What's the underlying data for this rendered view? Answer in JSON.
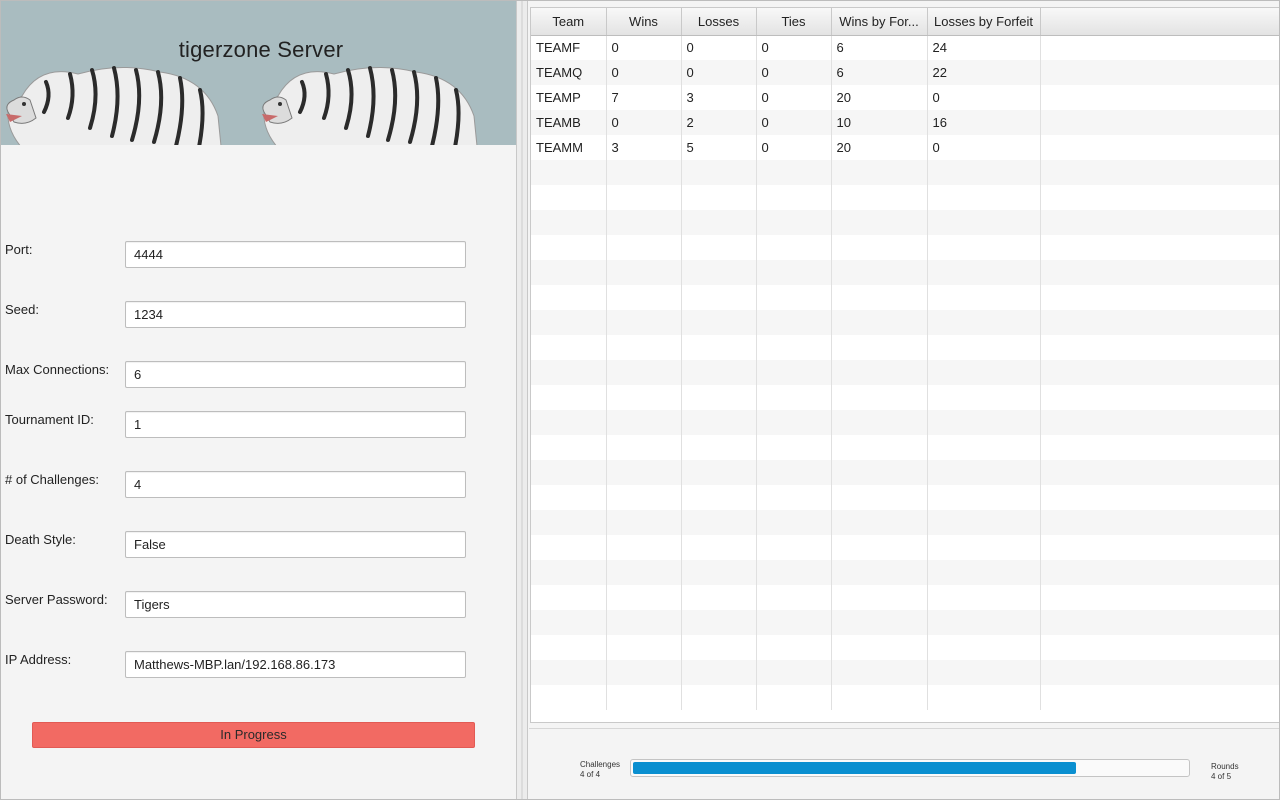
{
  "banner": {
    "title": "tigerzone Server"
  },
  "form": {
    "port": {
      "label": "Port:",
      "value": "4444"
    },
    "seed": {
      "label": "Seed:",
      "value": "1234"
    },
    "max_connections": {
      "label": "Max Connections:",
      "value": "6"
    },
    "tournament_id": {
      "label": "Tournament ID:",
      "value": "1"
    },
    "challenges": {
      "label": "# of Challenges:",
      "value": "4"
    },
    "death_style": {
      "label": "Death Style:",
      "value": "False"
    },
    "server_password": {
      "label": "Server Password:",
      "value": "Tigers"
    },
    "ip_address": {
      "label": "IP Address:",
      "value": "Matthews-MBP.lan/192.168.86.173"
    }
  },
  "status_button": {
    "label": "In Progress",
    "color": "#f26a63"
  },
  "table": {
    "columns": [
      "Team",
      "Wins",
      "Losses",
      "Ties",
      "Wins by For...",
      "Losses by Forfeit"
    ],
    "rows": [
      [
        "TEAMF",
        "0",
        "0",
        "0",
        "6",
        "24"
      ],
      [
        "TEAMQ",
        "0",
        "0",
        "0",
        "6",
        "22"
      ],
      [
        "TEAMP",
        "7",
        "3",
        "0",
        "20",
        "0"
      ],
      [
        "TEAMB",
        "0",
        "2",
        "0",
        "10",
        "16"
      ],
      [
        "TEAMM",
        "3",
        "5",
        "0",
        "20",
        "0"
      ]
    ]
  },
  "progress": {
    "challenges_label": "Challenges",
    "challenges_value": "4 of 4",
    "rounds_label": "Rounds",
    "rounds_value": "4 of 5",
    "fraction": 0.8,
    "fill_color": "#0a8fd0"
  }
}
